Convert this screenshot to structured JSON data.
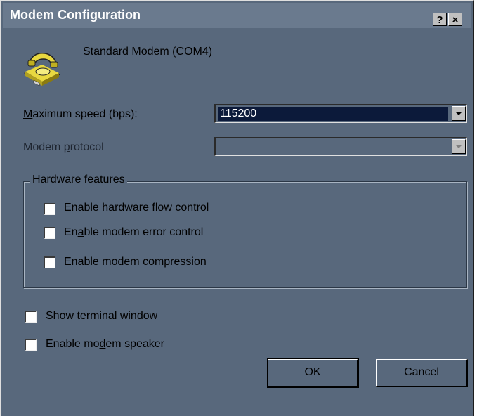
{
  "window": {
    "title": "Modem Configuration",
    "help_button": "?",
    "close_button": "×"
  },
  "device": {
    "name": "Standard Modem (COM4)",
    "icon": "modem-phone-icon"
  },
  "max_speed": {
    "label_pre": "",
    "label_u": "M",
    "label_post": "aximum speed (bps):",
    "value": "115200"
  },
  "protocol": {
    "label_pre": "Modem ",
    "label_u": "p",
    "label_post": "rotocol",
    "value": ""
  },
  "hardware": {
    "title": "Hardware features",
    "flow_control": {
      "pre": "E",
      "u": "n",
      "post": "able hardware flow control",
      "checked": false
    },
    "error_control": {
      "pre": "En",
      "u": "a",
      "post": "ble modem error control",
      "checked": false
    },
    "compression": {
      "pre": "Enable m",
      "u": "o",
      "post": "dem compression",
      "checked": false
    }
  },
  "options": {
    "terminal": {
      "pre": "",
      "u": "S",
      "post": "how terminal window",
      "checked": false
    },
    "speaker": {
      "pre": "Enable mo",
      "u": "d",
      "post": "em speaker",
      "checked": false
    }
  },
  "buttons": {
    "ok": "OK",
    "cancel": "Cancel"
  },
  "colors": {
    "dialog_bg": "#58687c",
    "titlebar": "#6a7a8e",
    "selection": "#0c1a3a"
  }
}
